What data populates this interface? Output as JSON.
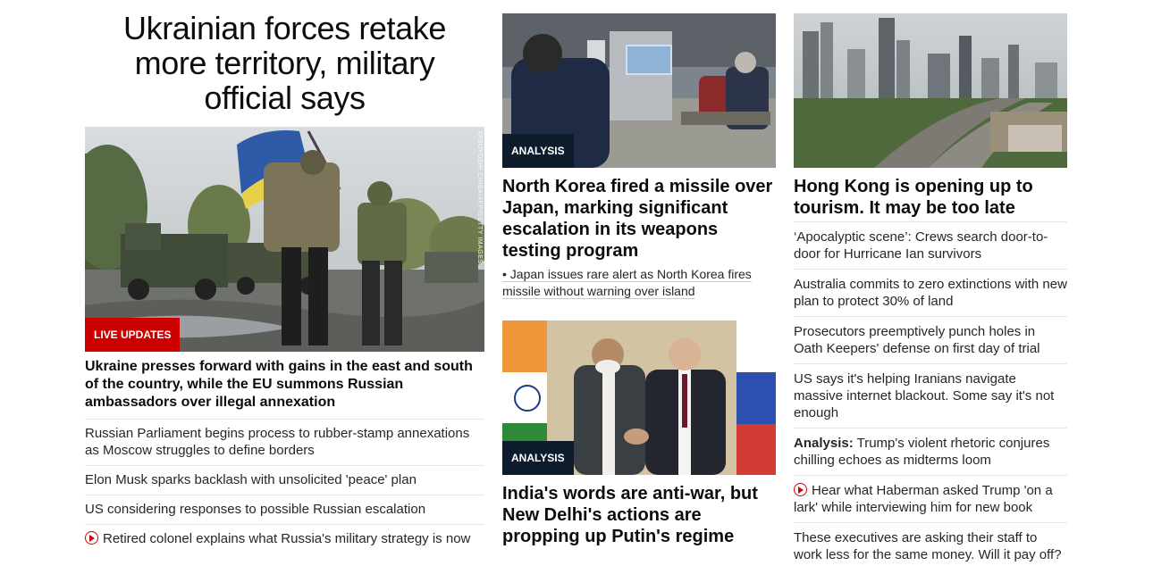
{
  "lead": {
    "headline": "Ukrainian forces retake more territory, military official says",
    "image_credit": "YASUYOSHI CHIBA/AFP/GETTY IMAGES",
    "badge": "LIVE UPDATES",
    "subhead": "Ukraine presses forward with gains in the east and south of the country, while the EU summons Russian ambassadors over illegal annexation",
    "related": [
      "Russian Parliament begins process to rubber-stamp annexations as Moscow struggles to define borders",
      "Elon Musk sparks backlash with unsolicited 'peace' plan",
      "US considering responses to possible Russian escalation",
      "Retired colonel explains what Russia's military strategy is now"
    ]
  },
  "middle": {
    "card1": {
      "badge": "ANALYSIS",
      "title": "North Korea fired a missile over Japan, marking significant escalation in its weapons testing program",
      "bullet": "• Japan issues rare alert as North Korea fires missile without warning over island"
    },
    "card2": {
      "badge": "ANALYSIS",
      "title": "India's words are anti-war, but New Delhi's actions are propping up Putin's regime"
    }
  },
  "right": {
    "title": "Hong Kong is opening up to tourism. It may be too late",
    "items": [
      {
        "text": "‘Apocalyptic scene’: Crews search door-to-door for Hurricane Ian survivors"
      },
      {
        "text": "Australia commits to zero extinctions with new plan to protect 30% of land"
      },
      {
        "text": "Prosecutors preemptively punch holes in Oath Keepers' defense on first day of trial"
      },
      {
        "text": "US says it's helping Iranians navigate massive internet blackout. Some say it's not enough"
      },
      {
        "prefix": "Analysis:",
        "text": " Trump's violent rhetoric conjures chilling echoes as midterms loom"
      },
      {
        "text": "Hear what Haberman asked Trump 'on a lark' while interviewing him for new book"
      },
      {
        "text": "These executives are asking their staff to work less for the same money. Will it pay off?"
      }
    ]
  },
  "colors": {
    "live_red": "#cc0000",
    "analysis_navy": "#0c1c2c",
    "divider": "#e6e6e6"
  }
}
